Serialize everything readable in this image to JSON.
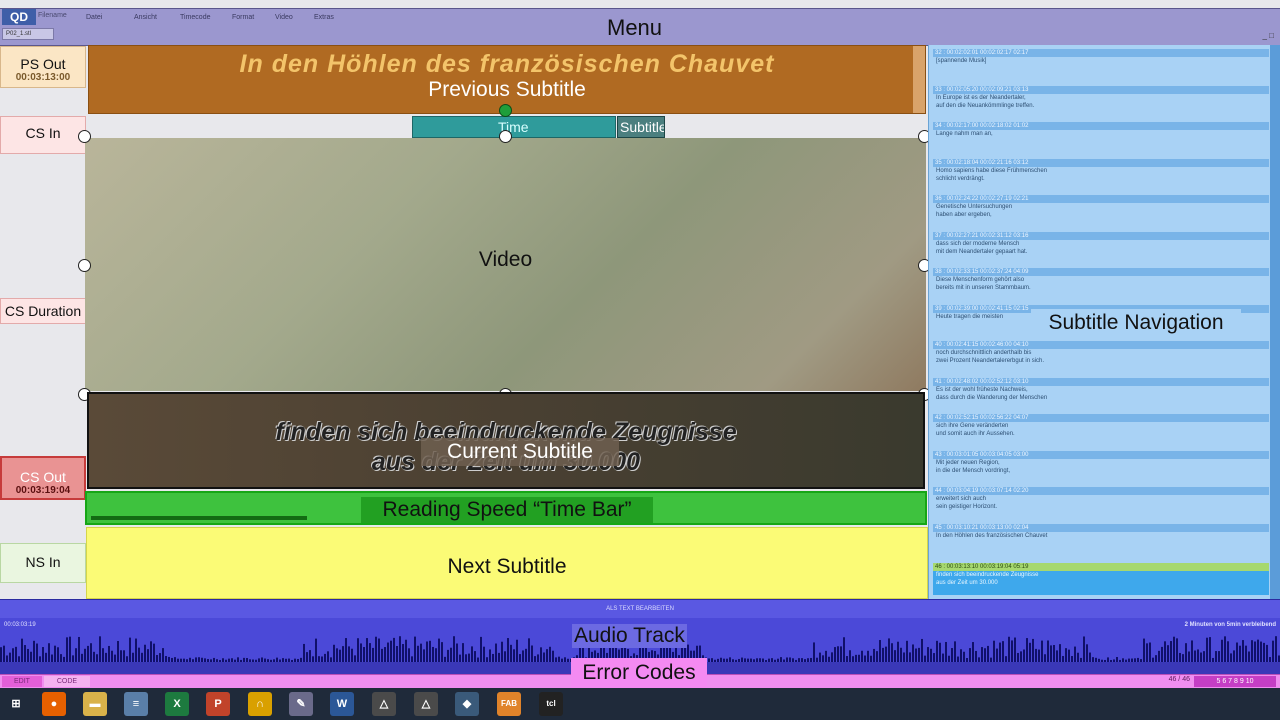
{
  "menu": {
    "label": "Menu",
    "logo": "QD",
    "app_title": "Filename",
    "items": [
      "Datei",
      "Ansicht",
      "Timecode",
      "Format",
      "Video",
      "Extras"
    ],
    "file_tab": "P02_1.stl",
    "window_controls": "_ □"
  },
  "left_column": {
    "ps_out": {
      "label": "PS Out",
      "timecode": "00:03:13:00"
    },
    "cs_in": {
      "label": "CS In"
    },
    "cs_duration": {
      "label": "CS Duration"
    },
    "cs_out": {
      "label": "CS Out",
      "timecode": "00:03:19:04"
    },
    "ns_in": {
      "label": "NS In"
    }
  },
  "previous_subtitle": {
    "text": "In den Höhlen des französischen Chauvet",
    "label": "Previous Subtitle"
  },
  "time_bar": {
    "label": "Time",
    "subtitle_label": "Subtitle N"
  },
  "video": {
    "label": "Video"
  },
  "current_subtitle": {
    "line1": "finden sich beeindruckende Zeugnisse",
    "line2": "aus der Zeit um 30.000",
    "label": "Current Subtitle"
  },
  "reading_speed": {
    "label": "Reading Speed “Time Bar”",
    "fill_fraction": 0.26
  },
  "next_subtitle": {
    "label": "Next Subtitle"
  },
  "subtitle_navigation": {
    "label": "Subtitle Navigation",
    "entries": [
      {
        "head": "32 : 00:02:02:01   00:02:02:17   02:17",
        "line1": "[spannende Musik]",
        "line2": ""
      },
      {
        "head": "33 : 00:02:05:20   00:02:09:21   03:13",
        "line1": "In Europe ist es der Neandertaler,",
        "line2": "auf den die Neuankömmlinge treffen."
      },
      {
        "head": "34 : 00:02:17:00   00:02:18:02   01:02",
        "line1": "Lange nahm man an,",
        "line2": ""
      },
      {
        "head": "35 : 00:02:18:04   00:02:21:16   03:12",
        "line1": "Homo sapiens habe diese Frühmenschen",
        "line2": "schlicht verdrängt."
      },
      {
        "head": "36 : 00:02:24:22   00:02:27:19   02:21",
        "line1": "Genetische Untersuchungen",
        "line2": "haben aber ergeben,"
      },
      {
        "head": "37 : 00:02:27:21   00:02:31:12   03:16",
        "line1": "dass sich der moderne Mensch",
        "line2": "mit dem Neandertaler gepaart hat."
      },
      {
        "head": "38 : 00:02:33:15   00:02:37:24   04:09",
        "line1": "Diese Menschenform gehört also",
        "line2": "bereits mit in unseren Stammbaum."
      },
      {
        "head": "39 : 00:02:39:00   00:02:41:15   02:15",
        "line1": "Heute tragen die meisten",
        "line2": ""
      },
      {
        "head": "40 : 00:02:41:15   00:02:46:00   04:10",
        "line1": "noch durchschnittlich anderthalb bis",
        "line2": "zwei Prozent Neandertalererbgut in sich."
      },
      {
        "head": "41 : 00:02:48:02   00:02:52:12   03:10",
        "line1": "Es ist der wohl früheste Nachweis,",
        "line2": "dass durch die Wanderung der Menschen"
      },
      {
        "head": "42 : 00:02:52:15   00:02:56:22   04:07",
        "line1": "sich ihre Gene veränderten",
        "line2": "und somit auch ihr Aussehen."
      },
      {
        "head": "43 : 00:03:01:05   00:03:04:05   03:00",
        "line1": "Mit jeder neuen Region,",
        "line2": "in die der Mensch vordringt,"
      },
      {
        "head": "44 : 00:03:04:19   00:03:07:14   02:20",
        "line1": "erweitert sich auch",
        "line2": "sein geistiger Horizont."
      },
      {
        "head": "45 : 00:03:10:21   00:03:13:00   02:04",
        "line1": "In den Höhlen des französischen Chauvet",
        "line2": ""
      }
    ],
    "selected": {
      "head": "46 : 00:03:13:10   00:03:19:04   05:19",
      "line1": "finden sich beeindruckende Zeugnisse",
      "line2": "aus der Zeit um 30.000"
    }
  },
  "audio": {
    "label": "Audio Track",
    "header": "ALS TEXT BEARBEITEN",
    "timecode": "00:03:03:19",
    "remaining": "2 Minuten von 5min verbleibend"
  },
  "errors": {
    "label": "Error Codes",
    "tab1": "EDIT",
    "tab2": "CODE",
    "zoom": "46 / 46",
    "codes": "5 6 7 8 9 10"
  },
  "taskbar": {
    "icons": [
      {
        "name": "windows-start-icon",
        "glyph": "⊞",
        "color": "#1f2a3a"
      },
      {
        "name": "firefox-icon",
        "glyph": "●",
        "color": "#e66000"
      },
      {
        "name": "file-explorer-icon",
        "glyph": "▬",
        "color": "#d9b24a"
      },
      {
        "name": "notepad-icon",
        "glyph": "≡",
        "color": "#5a7fa8"
      },
      {
        "name": "excel-icon",
        "glyph": "X",
        "color": "#1d7a3f"
      },
      {
        "name": "powerpoint-icon",
        "glyph": "P",
        "color": "#c1432a"
      },
      {
        "name": "headset-icon",
        "glyph": "∩",
        "color": "#d9a000"
      },
      {
        "name": "paint-icon",
        "glyph": "✎",
        "color": "#6a6a8a"
      },
      {
        "name": "word-icon",
        "glyph": "W",
        "color": "#2b5797"
      },
      {
        "name": "tool-icon-1",
        "glyph": "△",
        "color": "#4a4a4a"
      },
      {
        "name": "tool-icon-2",
        "glyph": "△",
        "color": "#4a4a4a"
      },
      {
        "name": "cube-icon",
        "glyph": "◆",
        "color": "#3a5a7a"
      },
      {
        "name": "fab-icon",
        "glyph": "FAB",
        "color": "#e0832a"
      },
      {
        "name": "tcl-icon",
        "glyph": "tcl",
        "color": "#222"
      }
    ]
  }
}
